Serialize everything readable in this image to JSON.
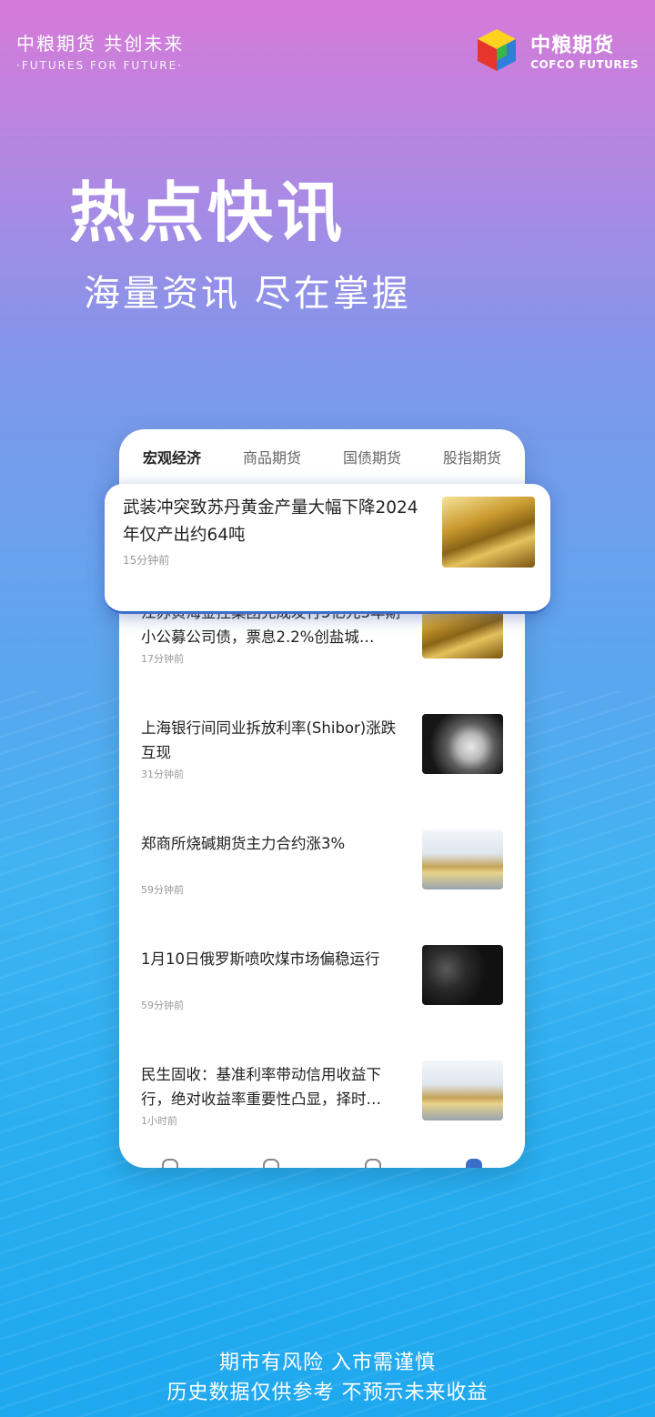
{
  "brand": {
    "slogan": "中粮期货  共创未来",
    "slogan_en": "·FUTURES FOR FUTURE·",
    "logo_cn": "中粮期货",
    "logo_en": "COFCO FUTURES"
  },
  "hero": {
    "title": "热点快讯",
    "subtitle": "海量资讯 尽在掌握"
  },
  "tabs": [
    "宏观经济",
    "商品期货",
    "国债期货",
    "股指期货"
  ],
  "featured": {
    "title": "武装冲突致苏丹黄金产量大幅下降2024年仅产出约64吨",
    "time": "15分钟前",
    "thumb": "gold-bars-image"
  },
  "news": [
    {
      "title": "江苏黄海金控集团完成发行5亿元3年期小公募公司债，票息2.2%创盐城…",
      "time": "17分钟前",
      "thumb": "gold-bars-image"
    },
    {
      "title": "上海银行间同业拆放利率(Shibor)涨跌互现",
      "time": "31分钟前",
      "thumb": "silver-coins-image"
    },
    {
      "title": "郑商所烧碱期货主力合约涨3%",
      "time": "59分钟前",
      "thumb": "coins-pen-image"
    },
    {
      "title": "1月10日俄罗斯喷吹煤市场偏稳运行",
      "time": "59分钟前",
      "thumb": "coal-image"
    },
    {
      "title": "民生固收：基准利率带动信用收益下行，绝对收益率重要性凸显，择时…",
      "time": "1小时前",
      "thumb": "coins-pen-image"
    }
  ],
  "disclaimer": {
    "line1": "期市有风险 入市需谨慎",
    "line2": "历史数据仅供参考 不预示未来收益"
  }
}
